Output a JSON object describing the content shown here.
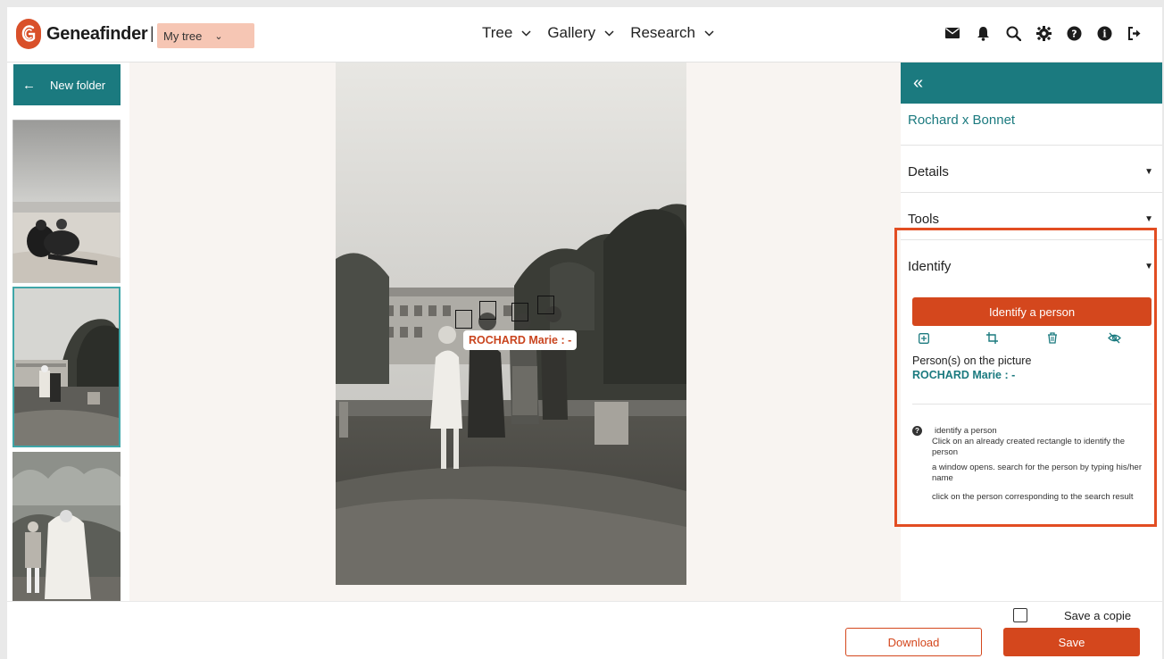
{
  "app": {
    "brand": "Geneafinder",
    "separator": "|",
    "tree_select": {
      "value": "My tree"
    }
  },
  "nav": {
    "items": [
      {
        "label": "Tree"
      },
      {
        "label": "Gallery"
      },
      {
        "label": "Research"
      }
    ]
  },
  "toolbar_icons": [
    "mail-icon",
    "bell-icon",
    "search-icon",
    "gear-icon",
    "help-icon",
    "info-icon",
    "logout-icon"
  ],
  "left_panel": {
    "back_label": "New folder",
    "thumbnails": [
      "beach-photo",
      "garden-photo",
      "communion-photo"
    ],
    "selected_index": 1
  },
  "viewer": {
    "face_label": "ROCHARD Marie : -"
  },
  "right_panel": {
    "collapse_glyph": "«",
    "title": "Rochard x Bonnet",
    "sections": {
      "details": "Details",
      "tools": "Tools",
      "identify": "Identify"
    },
    "identify": {
      "button_label": "Identify a person",
      "tool_icons": [
        "add-box-icon",
        "crop-icon",
        "trash-icon",
        "hide-eye-icon"
      ],
      "persons_label": "Person(s) on the picture",
      "persons": [
        "ROCHARD Marie : -"
      ],
      "help": {
        "title": "identify a person",
        "steps": [
          "Click on an already created rectangle to identify the person",
          "a window opens. search for the person by typing his/her name",
          "click on the person corresponding to the search result"
        ]
      }
    }
  },
  "footer": {
    "save_copy_label": "Save a copie",
    "save_copy_checked": false,
    "download_label": "Download",
    "save_label": "Save"
  },
  "colors": {
    "accent": "#d4471d",
    "teal": "#1b7a7f",
    "highlight": "#e24d22",
    "tree_select_bg": "#f6c6b4"
  }
}
